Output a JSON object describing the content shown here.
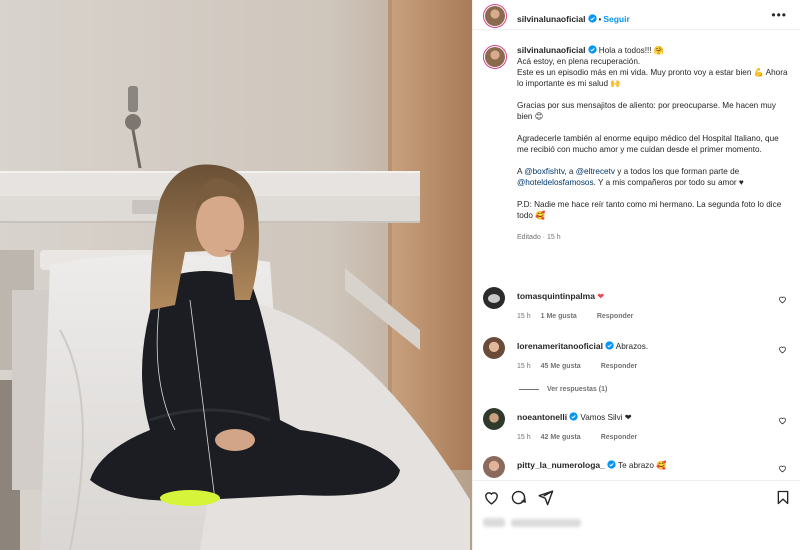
{
  "post": {
    "image_alt": "",
    "likes_text": ""
  },
  "header": {
    "username": "silvinalunaoficial",
    "follow_label": "Seguir",
    "separator": "•",
    "more_label": "•••"
  },
  "caption": {
    "username": "silvinalunaoficial",
    "line1": "Hola a todos!!! 🤗",
    "line2": "Acá estoy, en plena recuperación.",
    "line3": "Este es un episodio más en mi vida. Muy pronto voy a estar bien 💪 Ahora lo importante es mi salud 🙌",
    "para2": "Gracias por sus mensajitos de aliento: por preocuparse. Me hacen muy bien 😊",
    "para3": "Agradecerle también al enorme equipo médico del Hospital Italiano, que me recibió con mucho amor y me cuidan desde el primer momento.",
    "para4_a": "A ",
    "mention1": "@boxfishtv",
    "para4_b": ", a ",
    "mention2": "@eltrecetv",
    "para4_c": " y a todos los que forman parte de ",
    "mention3": "@hoteldelosfamosos",
    "para4_d": ". Y a mis compañeros por todo su amor ♥",
    "para5": "P.D: Nadie me hace reír tanto como mi hermano. La segunda foto lo dice todo 🥰",
    "edited": "Editado · 15 h"
  },
  "comments": [
    {
      "username": "tomasquintinpalma",
      "text": " ❤",
      "time": "15 h",
      "likes": "1 Me gusta",
      "reply": "Responder",
      "verified": false,
      "avatar_color": "#2b2b2b"
    },
    {
      "username": "lorenameritanooficial",
      "text": " Abrazos.",
      "time": "15 h",
      "likes": "45 Me gusta",
      "reply": "Responder",
      "verified": true,
      "avatar_color": "#b98a70"
    },
    {
      "username": "noeantonelli",
      "text": " Vamos Silvi ❤",
      "time": "15 h",
      "likes": "42 Me gusta",
      "reply": "Responder",
      "verified": true,
      "avatar_color": "#3d4a3a"
    },
    {
      "username": "pitty_la_numerologa_",
      "text": " Te abrazo 🥰",
      "verified": true,
      "avatar_color": "#a0847a"
    }
  ],
  "replies_label": "Ver respuestas (1)",
  "colors": {
    "accent": "#0095f6",
    "verified": "#0095f6",
    "heart": "#ed4956",
    "mention": "#00376b",
    "muted": "#737373"
  },
  "icons": [
    "verified-badge-icon",
    "more-options-icon",
    "heart-icon",
    "comment-icon",
    "share-icon",
    "bookmark-icon"
  ]
}
